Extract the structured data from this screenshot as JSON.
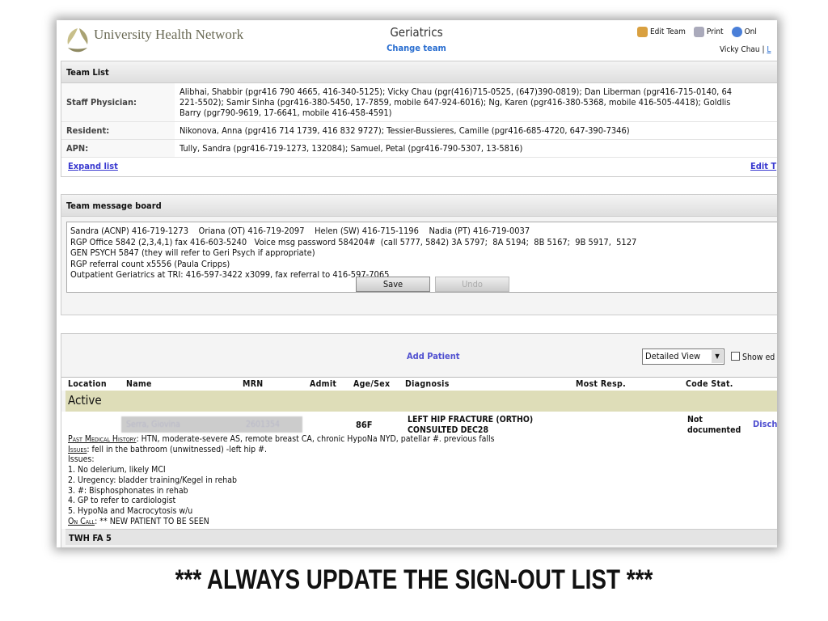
{
  "header": {
    "logo_text": "University Health Network",
    "title": "Geriatrics",
    "change_team": "Change team",
    "edit_team": "Edit Team",
    "print": "Print",
    "online": "Onl",
    "user": "Vicky Chau",
    "separator": "|",
    "user_link": "L"
  },
  "team_list": {
    "title": "Team List",
    "rows": [
      {
        "label": "Staff Physician:",
        "value": "Alibhai, Shabbir (pgr416 790 4665, 416-340-5125); Vicky Chau (pgr(416)715-0525, (647)390-0819); Dan Liberman (pgr416-715-0140, 64",
        "value2": "221-5502); Samir Sinha (pgr416-380-5450, 17-7859, mobile 647-924-6016); Ng, Karen (pgr416-380-5368, mobile 416-505-4418); Goldlis",
        "value3": "Barry (pgr790-9619, 17-6641, mobile 416-458-4591)"
      },
      {
        "label": "Resident:",
        "value": "Nikonova, Anna (pgr416 714 1739, 416 832 9727); Tessier-Bussieres, Camille (pgr416-685-4720, 647-390-7346)"
      },
      {
        "label": "APN:",
        "value": "Tully, Sandra (pgr416-719-1273, 132084); Samuel, Petal (pgr416-790-5307, 13-5816)"
      }
    ],
    "expand": "Expand list",
    "edit": "Edit T"
  },
  "message_board": {
    "title": "Team message board",
    "lines": [
      "Sandra (ACNP) 416-719-1273    Oriana (OT) 416-719-2097    Helen (SW) 416-715-1196    Nadia (PT) 416-719-0037",
      "RGP Office 5842 (2,3,4,1) fax 416-603-5240   Voice msg password 584204#  (call 5777, 5842) 3A 5797;  8A 5194;  8B 5167;  9B 5917,  5127",
      "GEN PSYCH 5847 (they will refer to Geri Psych if appropriate)",
      "RGP referral count x5556 (Paula Cripps)",
      "Outpatient Geriatrics at TRI: 416-597-3422 x3099, fax referral to 416-597-7065"
    ],
    "save": "Save",
    "undo": "Undo"
  },
  "patients": {
    "add_patient": "Add Patient",
    "view": "Detailed View",
    "show": "Show ed",
    "columns": [
      "Location",
      "Name",
      "MRN",
      "Admit",
      "Age/Sex",
      "Diagnosis",
      "Most Resp.",
      "Code Stat."
    ],
    "group": "Active",
    "patient": {
      "name": "Serra, Giovina",
      "mrn": "2601354",
      "age_sex": "86F",
      "diagnosis1": "LEFT HIP FRACTURE (ORTHO)",
      "diagnosis2": "CONSULTED DEC28",
      "code1": "Not",
      "code2": "documented",
      "discharge": "Disch"
    },
    "notes": {
      "pmh_label": "Past Medical History",
      "pmh": ": HTN, moderate-severe AS, remote breast CA, chronic HypoNa NYD, patellar #. previous falls",
      "issues_label": "Issues",
      "issues": ": fell in the bathroom (unwitnessed) -left hip #.",
      "lines": [
        "Issues:",
        "1. No delerium, likely MCI",
        "2. Uregency: bladder training/Kegel in rehab",
        "3. #: Bisphosphonates in rehab",
        "4. GP to refer to cardiologist",
        "5. HypoNa and Macrocytosis w/u"
      ],
      "oncall_label": "On Call",
      "oncall": ": ** NEW PATIENT TO BE SEEN"
    },
    "next_group": "TWH FA 5"
  },
  "caption": "*** ALWAYS UPDATE THE SIGN-OUT LIST ***"
}
